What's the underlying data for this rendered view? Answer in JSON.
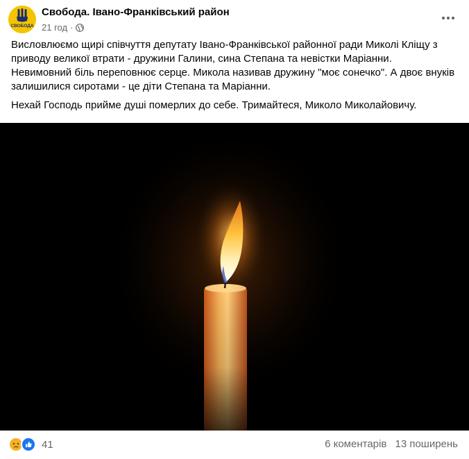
{
  "post": {
    "page_name": "Свобода. Івано-Франківський район",
    "avatar_text": "СВОБОДА",
    "timestamp": "21 год",
    "separator": "·",
    "privacy_icon": "globe-icon",
    "more_icon": "more-horizontal-icon",
    "paragraphs": [
      "Висловлюємо щирі співчуття депутату Івано-Франківської районної ради Миколі Кліщу з приводу великої втрати - дружини Галини, сина Степана та невістки Маріанни. Невимовний біль переповнює серце. Микола називав дружину \"моє сонечко\". А двоє внуків залишилися сиротами - це діти Степана та Маріанни.",
      "Нехай Господь прийме душі померлих до себе. Тримайтеся, Миколо Миколайовичу."
    ],
    "image_icon": "candle-image"
  },
  "footer": {
    "reaction_icons": [
      "sad-reaction-icon",
      "like-reaction-icon"
    ],
    "reaction_count": "41",
    "comments": "6 коментарів",
    "shares": "13 поширень"
  },
  "colors": {
    "page_background": "#ffffff",
    "text": "#050505",
    "secondary_text": "#65676b",
    "avatar_yellow": "#f5c400",
    "like_blue": "#1877f2",
    "sad_yellow": "#f7b125"
  }
}
